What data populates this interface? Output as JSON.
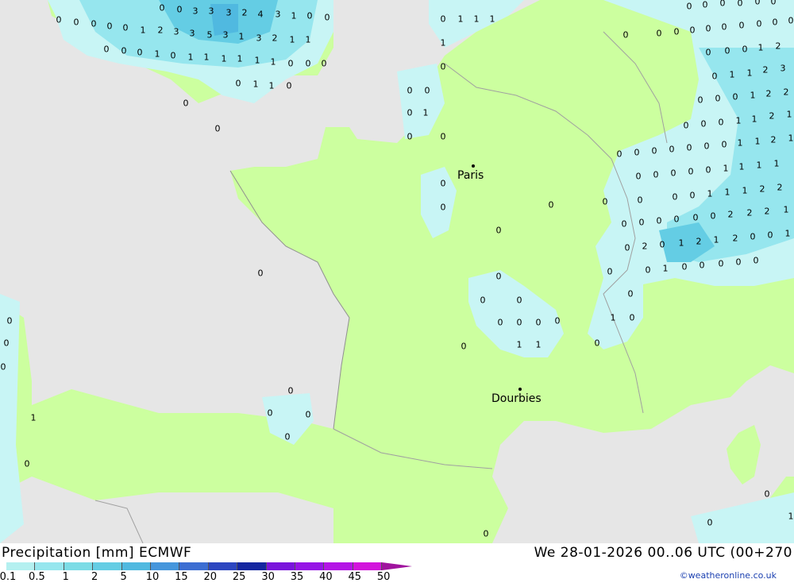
{
  "title": {
    "left": "Precipitation [mm] ECMWF",
    "right": "We 28-01-2026 00..06 UTC (00+270"
  },
  "credit": "©weatheronline.co.uk",
  "cities": [
    {
      "name": "Paris"
    },
    {
      "name": "Dourbies"
    }
  ],
  "legend": {
    "labels": [
      "0.1",
      "0.5",
      "1",
      "2",
      "5",
      "10",
      "15",
      "20",
      "25",
      "30",
      "35",
      "40",
      "45",
      "50"
    ],
    "colors": [
      "#b4f0f0",
      "#96e6ee",
      "#7cdce6",
      "#64cde4",
      "#50b9e0",
      "#4696dc",
      "#3c6ed2",
      "#2c46c0",
      "#1426a0",
      "#7a14dc",
      "#9614e6",
      "#b414e6",
      "#d214dc",
      "#a0149e"
    ]
  },
  "colors": {
    "land": "#ccff9f",
    "sea": "#e6e6e6",
    "light_precip": "#c8f5f5",
    "medium_precip": "#96e6ee",
    "heavy_precip": "#64b9e0",
    "border": "#a0a0a0"
  },
  "values": [
    "0",
    "1",
    "2",
    "3",
    "4",
    "5"
  ]
}
